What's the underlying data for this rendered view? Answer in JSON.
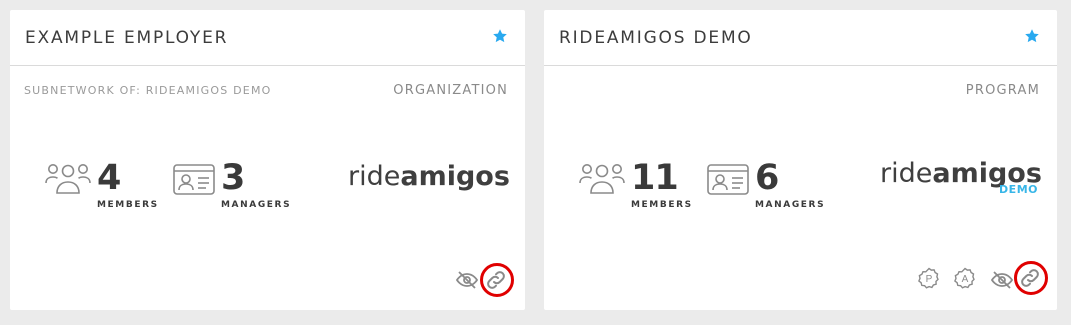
{
  "colors": {
    "accent": "#29a9ef",
    "highlight": "#e00000",
    "demo": "#38b6e8"
  },
  "cards": [
    {
      "title": "EXAMPLE EMPLOYER",
      "starred": true,
      "subnetwork": "SUBNETWORK OF: RIDEAMIGOS DEMO",
      "type": "ORGANIZATION",
      "members_value": "4",
      "members_label": "MEMBERS",
      "managers_value": "3",
      "managers_label": "MANAGERS",
      "logo_light": "ride",
      "logo_bold": "amigos",
      "logo_sub": "",
      "actions": [
        "hidden-eye-icon",
        "link-icon"
      ]
    },
    {
      "title": "RIDEAMIGOS DEMO",
      "starred": true,
      "subnetwork": "",
      "type": "PROGRAM",
      "members_value": "11",
      "members_label": "MEMBERS",
      "managers_value": "6",
      "managers_label": "MANAGERS",
      "logo_light": "ride",
      "logo_bold": "amigos",
      "logo_sub": "DEMO",
      "badge_p": "P",
      "badge_a": "A",
      "actions": [
        "p-badge-icon",
        "a-badge-icon",
        "hidden-eye-icon",
        "link-icon"
      ]
    }
  ]
}
